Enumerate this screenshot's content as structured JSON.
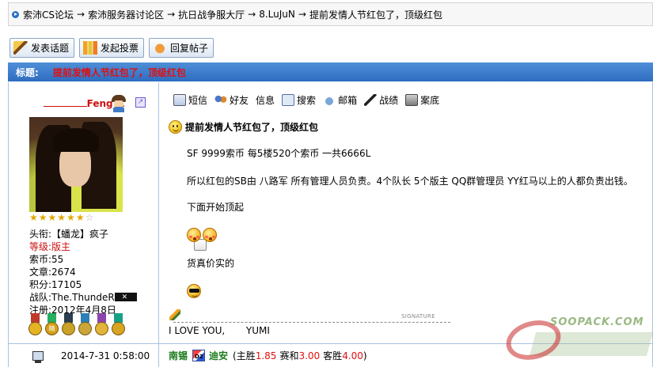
{
  "breadcrumb": [
    {
      "label": "索沛CS论坛"
    },
    {
      "label": "索沛服务器讨论区"
    },
    {
      "label": "抗日战争服大厅"
    },
    {
      "label": "8.LuJuN"
    },
    {
      "label": "提前发情人节红包了，顶级红包"
    }
  ],
  "breadcrumb_separator": "→",
  "toolbar": {
    "new_topic": "发表话题",
    "new_poll": "发起投票",
    "reply": "回复帖子"
  },
  "thread": {
    "label": "标题:",
    "title": "提前发情人节红包了，顶级红包"
  },
  "user": {
    "name": "Feng_Z",
    "stars_filled": 6,
    "stars_total": 7,
    "title_label": "头衔:",
    "title_value": "【蟠龙】疯子",
    "level_label": "等级:",
    "level_value": "版主",
    "coins_label": "索币:",
    "coins_value": "55",
    "posts_label": "文章:",
    "posts_value": "2674",
    "points_label": "积分:",
    "points_value": "17105",
    "clan_label": "战队:",
    "clan_value": "The.ThundeR",
    "reg_label": "注册:",
    "reg_value": "2012年4月8日",
    "medals": [
      {
        "text": "",
        "ribbon": "#c0392b",
        "disc": "#e6b422"
      },
      {
        "text": "",
        "ribbon": "#27ae60",
        "disc": "#d4a017"
      },
      {
        "text": "",
        "ribbon": "#2c3e50",
        "disc": "#c9a227"
      },
      {
        "text": "",
        "ribbon": "#2980b9",
        "disc": "#caa53a"
      },
      {
        "text": "",
        "ribbon": "#8e44ad",
        "disc": "#e2b53a"
      },
      {
        "text": "",
        "ribbon": "#16a085",
        "disc": "#d9a520"
      }
    ],
    "medal_text_2": "精"
  },
  "actions": {
    "sms": "短信",
    "friend": "好友",
    "info": "信息",
    "search": "搜索",
    "mail": "邮箱",
    "record": "战绩",
    "case": "案底"
  },
  "post": {
    "title": "提前发情人节红包了，顶级红包",
    "line1": "SF  9999索币  每5楼520个索币  一共6666L",
    "line2": "所以红包的SB由  八路军  所有管理人员负责。4个队长  5个版主  QQ群管理员  YY红马以上的人都负责出钱。",
    "line3": "下面开始顶起",
    "line4": "货真价实的",
    "signature_label": "SIGNATURE",
    "signature_text": "I LOVE YOU,       YUMI"
  },
  "footer": {
    "time": "2014-7-31 0:58:00",
    "team_a": "南锡",
    "team_b": "迪安",
    "home_win_label": "(主胜",
    "home_odds": "1.85",
    "draw_label": "赛和",
    "draw_odds": "3.00",
    "away_label": "客胜",
    "away_odds": "4.00",
    "close_paren": ")"
  },
  "watermark": {
    "text": "SOOPACK.COM"
  },
  "colors": {
    "title_red": "#e01010",
    "title_bar_blue": "#2e6cc0",
    "team_green": "#1a7a1a"
  }
}
